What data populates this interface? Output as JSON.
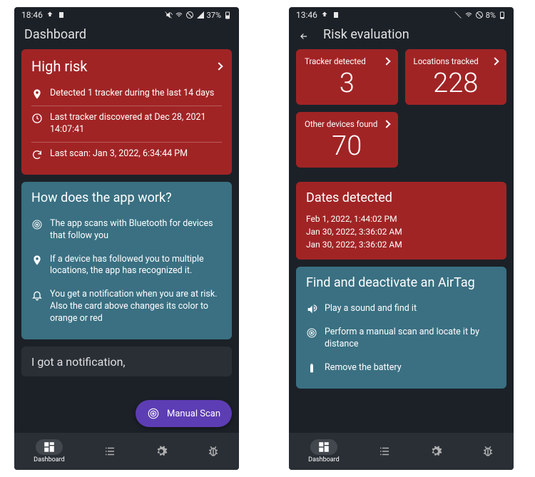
{
  "left": {
    "status": {
      "time": "18:46",
      "battery": "37%"
    },
    "header": "Dashboard",
    "risk": {
      "title": "High risk",
      "line1": "Detected 1 tracker during the last 14 days",
      "line2": "Last tracker discovered at Dec 28, 2021 14:07:41",
      "line3": "Last scan: Jan 3, 2022, 6:34:44 PM"
    },
    "how": {
      "title": "How does  the app  work?",
      "line1": "The app  scans with Bluetooth for devices that follow you",
      "line2": "If a device has followed you to multiple locations,  the app  has recognized it.",
      "line3": "You get a notification when you are at risk. Also the card above changes its color to orange or red"
    },
    "cutoff": "I got a notification,",
    "fab": "Manual Scan",
    "nav_label": "Dashboard"
  },
  "right": {
    "status": {
      "time": "13:46",
      "battery": "8%"
    },
    "header": "Risk evaluation",
    "stats": {
      "trackers": {
        "label": "Tracker detected",
        "value": "3"
      },
      "locations": {
        "label": "Locations tracked",
        "value": "228"
      },
      "other": {
        "label": "Other devices found",
        "value": "70"
      }
    },
    "dates": {
      "title": "Dates detected",
      "list": [
        "Feb 1, 2022, 1:44:02 PM",
        "Jan 30, 2022, 3:36:02 AM",
        "Jan 30, 2022, 3:36:02 AM"
      ]
    },
    "find": {
      "title": "Find and deactivate an AirTag",
      "line1": "Play a sound and find it",
      "line2": "Perform a manual scan and locate it by distance",
      "line3": "Remove the battery"
    },
    "nav_label": "Dashboard"
  }
}
